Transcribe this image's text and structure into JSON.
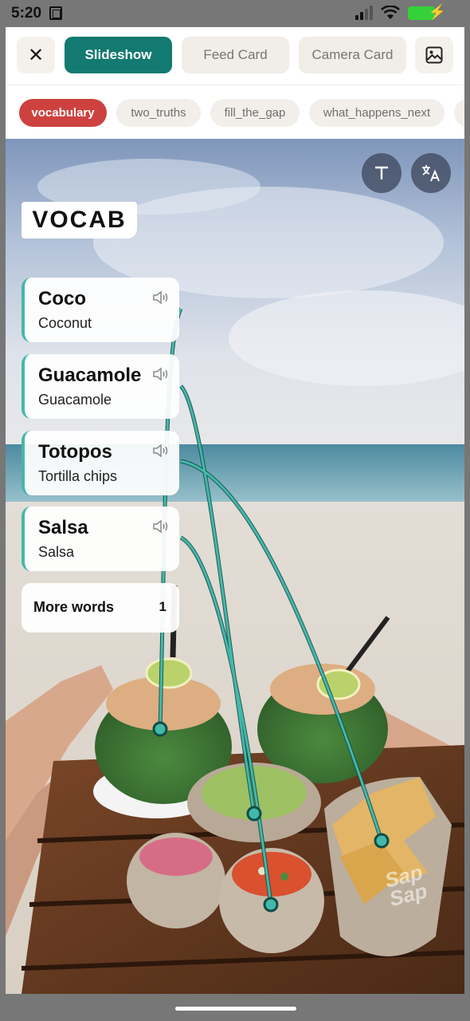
{
  "status": {
    "time": "5:20"
  },
  "header": {
    "close_icon": "close-icon",
    "tabs": [
      {
        "label": "Slideshow",
        "active": true
      },
      {
        "label": "Feed Card",
        "active": false
      },
      {
        "label": "Camera Card",
        "active": false
      }
    ],
    "image_icon": "image-icon"
  },
  "chips": [
    {
      "label": "vocabulary",
      "active": true
    },
    {
      "label": "two_truths",
      "active": false
    },
    {
      "label": "fill_the_gap",
      "active": false
    },
    {
      "label": "what_happens_next",
      "active": false
    }
  ],
  "overlay": {
    "text_tool_icon": "text-icon",
    "translate_icon": "translate-icon",
    "title": "VOCAB",
    "cards": [
      {
        "word": "Coco",
        "translation": "Coconut",
        "audio_icon": "speaker-icon"
      },
      {
        "word": "Guacamole",
        "translation": "Guacamole",
        "audio_icon": "speaker-icon"
      },
      {
        "word": "Totopos",
        "translation": "Tortilla chips",
        "audio_icon": "speaker-icon"
      },
      {
        "word": "Salsa",
        "translation": "Salsa",
        "audio_icon": "speaker-icon"
      }
    ],
    "more": {
      "label": "More words",
      "count": "1"
    },
    "watermark": "Sap Sap"
  },
  "colors": {
    "accent_teal": "#127a70",
    "chip_red": "#cd423f",
    "connector": "#43b8aa"
  }
}
